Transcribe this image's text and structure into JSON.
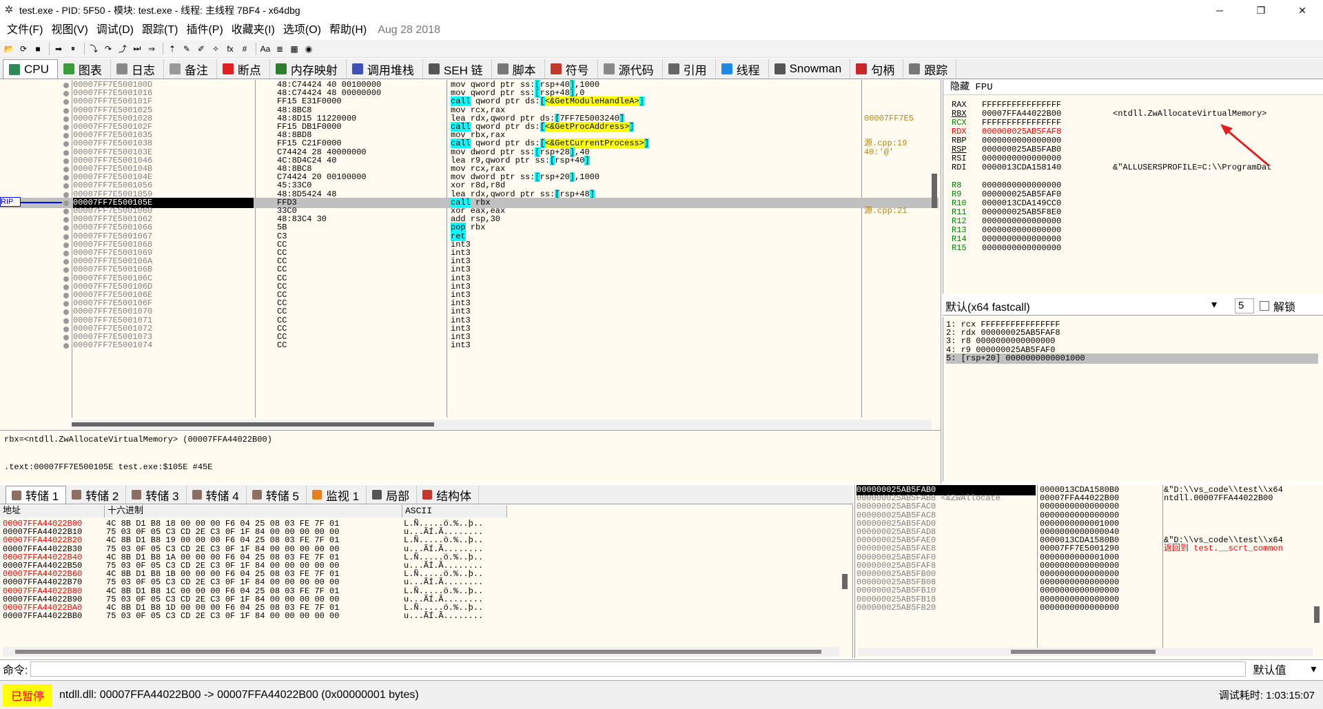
{
  "title": "test.exe - PID: 5F50 - 模块: test.exe - 线程: 主线程 7BF4 - x64dbg",
  "window_controls": {
    "minimize": "─",
    "maximize": "❐",
    "close": "✕"
  },
  "menu": [
    "文件(F)",
    "视图(V)",
    "调试(D)",
    "跟踪(T)",
    "插件(P)",
    "收藏夹(I)",
    "选项(O)",
    "帮助(H)"
  ],
  "menu_date": "Aug 28 2018",
  "toolbar_icons": [
    "open-icon",
    "restart-icon",
    "stop-icon",
    "run-icon",
    "pause-icon",
    "step-into-icon",
    "step-over-icon",
    "run-to-return-icon",
    "execute-till-user-icon",
    "animate-into-icon",
    "patch-icon",
    "comment-icon",
    "label-icon",
    "bookmark-icon",
    "function-icon",
    "hash-icon",
    "font-icon",
    "strings-icon",
    "calculator-icon",
    "globe-icon"
  ],
  "toolbar_glyphs": [
    "📂",
    "⟳",
    "■",
    "➡",
    "⏸",
    "⤵",
    "↷",
    "⤴",
    "⏭",
    "⇒",
    "⇡",
    "✎",
    "✐",
    "✧",
    "fx",
    "#",
    "Aa",
    "≣",
    "▦",
    "◉"
  ],
  "tabs": [
    {
      "label": "CPU",
      "color": "#2e8b57"
    },
    {
      "label": "图表",
      "color": "#3a9d3a"
    },
    {
      "label": "日志",
      "color": "#888888"
    },
    {
      "label": "备注",
      "color": "#999999"
    },
    {
      "label": "断点",
      "color": "#e02020"
    },
    {
      "label": "内存映射",
      "color": "#2e7d32"
    },
    {
      "label": "调用堆栈",
      "color": "#3f51b5"
    },
    {
      "label": "SEH 链",
      "color": "#555555"
    },
    {
      "label": "脚本",
      "color": "#777777"
    },
    {
      "label": "符号",
      "color": "#c0392b"
    },
    {
      "label": "源代码",
      "color": "#888888"
    },
    {
      "label": "引用",
      "color": "#666666"
    },
    {
      "label": "线程",
      "color": "#1e88e5"
    },
    {
      "label": "Snowman",
      "color": "#555555"
    },
    {
      "label": "句柄",
      "color": "#c62828"
    },
    {
      "label": "跟踪",
      "color": "#777777"
    }
  ],
  "disasm": [
    {
      "addr": "00007FF7E500100D",
      "bytes": "48:C74424 40 00100000",
      "dis": "mov qword ptr ss:[rsp+40],1000",
      "cmt": ""
    },
    {
      "addr": "00007FF7E5001016",
      "bytes": "48:C74424 48 00000000",
      "dis": "mov qword ptr ss:[rsp+48],0",
      "cmt": ""
    },
    {
      "addr": "00007FF7E500101F",
      "bytes": "FF15 E31F0000",
      "dis": "call qword ptr ds:[<&GetModuleHandleA>]",
      "cmt": ""
    },
    {
      "addr": "00007FF7E5001025",
      "bytes": "48:8BC8",
      "dis": "mov rcx,rax",
      "cmt": ""
    },
    {
      "addr": "00007FF7E5001028",
      "bytes": "48:8D15 11220000",
      "dis": "lea rdx,qword ptr ds:[7FF7E5003240]",
      "cmt": "00007FF7E5"
    },
    {
      "addr": "00007FF7E500102F",
      "bytes": "FF15 DB1F0000",
      "dis": "call qword ptr ds:[<&GetProcAddress>]",
      "cmt": ""
    },
    {
      "addr": "00007FF7E5001035",
      "bytes": "48:8BD8",
      "dis": "mov rbx,rax",
      "cmt": ""
    },
    {
      "addr": "00007FF7E5001038",
      "bytes": "FF15 C21F0000",
      "dis": "call qword ptr ds:[<&GetCurrentProcess>]",
      "cmt": "源.cpp:19"
    },
    {
      "addr": "00007FF7E500103E",
      "bytes": "C74424 28 40000000",
      "dis": "mov dword ptr ss:[rsp+28],40",
      "cmt": "40:'@'"
    },
    {
      "addr": "00007FF7E5001046",
      "bytes": "4C:8D4C24 40",
      "dis": "lea r9,qword ptr ss:[rsp+40]",
      "cmt": ""
    },
    {
      "addr": "00007FF7E500104B",
      "bytes": "48:8BC8",
      "dis": "mov rcx,rax",
      "cmt": ""
    },
    {
      "addr": "00007FF7E500104E",
      "bytes": "C74424 20 00100000",
      "dis": "mov dword ptr ss:[rsp+20],1000",
      "cmt": ""
    },
    {
      "addr": "00007FF7E5001056",
      "bytes": "45:33C0",
      "dis": "xor r8d,r8d",
      "cmt": ""
    },
    {
      "addr": "00007FF7E5001059",
      "bytes": "48:8D5424 48",
      "dis": "lea rdx,qword ptr ss:[rsp+48]",
      "cmt": ""
    },
    {
      "addr": "00007FF7E500105E",
      "bytes": "FFD3",
      "dis": "call rbx",
      "cmt": ""
    },
    {
      "addr": "00007FF7E5001060",
      "bytes": "33C0",
      "dis": "xor eax,eax",
      "cmt": "源.cpp:21"
    },
    {
      "addr": "00007FF7E5001062",
      "bytes": "48:83C4 30",
      "dis": "add rsp,30",
      "cmt": ""
    },
    {
      "addr": "00007FF7E5001066",
      "bytes": "5B",
      "dis": "pop rbx",
      "cmt": ""
    },
    {
      "addr": "00007FF7E5001067",
      "bytes": "C3",
      "dis": "ret",
      "cmt": ""
    },
    {
      "addr": "00007FF7E5001068",
      "bytes": "CC",
      "dis": "int3",
      "cmt": ""
    },
    {
      "addr": "00007FF7E5001069",
      "bytes": "CC",
      "dis": "int3",
      "cmt": ""
    },
    {
      "addr": "00007FF7E500106A",
      "bytes": "CC",
      "dis": "int3",
      "cmt": ""
    },
    {
      "addr": "00007FF7E500106B",
      "bytes": "CC",
      "dis": "int3",
      "cmt": ""
    },
    {
      "addr": "00007FF7E500106C",
      "bytes": "CC",
      "dis": "int3",
      "cmt": ""
    },
    {
      "addr": "00007FF7E500106D",
      "bytes": "CC",
      "dis": "int3",
      "cmt": ""
    },
    {
      "addr": "00007FF7E500106E",
      "bytes": "CC",
      "dis": "int3",
      "cmt": ""
    },
    {
      "addr": "00007FF7E500106F",
      "bytes": "CC",
      "dis": "int3",
      "cmt": ""
    },
    {
      "addr": "00007FF7E5001070",
      "bytes": "CC",
      "dis": "int3",
      "cmt": ""
    },
    {
      "addr": "00007FF7E5001071",
      "bytes": "CC",
      "dis": "int3",
      "cmt": ""
    },
    {
      "addr": "00007FF7E5001072",
      "bytes": "CC",
      "dis": "int3",
      "cmt": ""
    },
    {
      "addr": "00007FF7E5001073",
      "bytes": "CC",
      "dis": "int3",
      "cmt": ""
    },
    {
      "addr": "00007FF7E5001074",
      "bytes": "CC",
      "dis": "int3",
      "cmt": ""
    }
  ],
  "rip_label": "RIP",
  "rip_index": 14,
  "info": {
    "line1": "rbx=<ntdll.ZwAllocateVirtualMemory> (00007FFA44022B00)",
    "line2": ".text:00007FF7E500105E test.exe:$105E #45E"
  },
  "regs_header": "隐藏 FPU",
  "registers": [
    {
      "name": "RAX",
      "value": "FFFFFFFFFFFFFFFF",
      "note": "",
      "changed": false
    },
    {
      "name": "RBX",
      "value": "00007FFA44022B00",
      "note": "<ntdll.ZwAllocateVirtualMemory>",
      "changed": false
    },
    {
      "name": "RCX",
      "value": "FFFFFFFFFFFFFFFF",
      "note": "",
      "changed": false
    },
    {
      "name": "RDX",
      "value": "000000025AB5FAF8",
      "note": "",
      "changed": true
    },
    {
      "name": "RBP",
      "value": "0000000000000000",
      "note": "",
      "changed": false
    },
    {
      "name": "RSP",
      "value": "000000025AB5FAB0",
      "note": "",
      "changed": false
    },
    {
      "name": "RSI",
      "value": "0000000000000000",
      "note": "",
      "changed": false
    },
    {
      "name": "RDI",
      "value": "0000013CDA158140",
      "note": "&\"ALLUSERSPROFILE=C:\\\\ProgramDat",
      "changed": false
    },
    {
      "name": "",
      "value": "",
      "note": "",
      "changed": false
    },
    {
      "name": "R8",
      "value": "0000000000000000",
      "note": "",
      "changed": false
    },
    {
      "name": "R9",
      "value": "000000025AB5FAF0",
      "note": "",
      "changed": false
    },
    {
      "name": "R10",
      "value": "0000013CDA149CC0",
      "note": "",
      "changed": false
    },
    {
      "name": "R11",
      "value": "000000025AB5F8E0",
      "note": "",
      "changed": false
    },
    {
      "name": "R12",
      "value": "0000000000000000",
      "note": "",
      "changed": false
    },
    {
      "name": "R13",
      "value": "0000000000000000",
      "note": "",
      "changed": false
    },
    {
      "name": "R14",
      "value": "0000000000000000",
      "note": "",
      "changed": false
    },
    {
      "name": "R15",
      "value": "0000000000000000",
      "note": "",
      "changed": false
    }
  ],
  "callconv": {
    "label": "默认(x64 fastcall)",
    "count": "5",
    "unlock": "解锁"
  },
  "args": [
    "1: rcx FFFFFFFFFFFFFFFF",
    "2: rdx 000000025AB5FAF8",
    "3: r8 0000000000000000",
    "4: r9 000000025AB5FAF0",
    "5: [rsp+20] 0000000000001000"
  ],
  "bottom_tabs": [
    {
      "label": "转储 1",
      "color": "#8d6e63"
    },
    {
      "label": "转储 2",
      "color": "#8d6e63"
    },
    {
      "label": "转储 3",
      "color": "#8d6e63"
    },
    {
      "label": "转储 4",
      "color": "#8d6e63"
    },
    {
      "label": "转储 5",
      "color": "#8d6e63"
    },
    {
      "label": "监视 1",
      "color": "#e67e22"
    },
    {
      "label": "局部",
      "color": "#555555"
    },
    {
      "label": "结构体",
      "color": "#c0392b"
    }
  ],
  "dump_headers": {
    "addr": "地址",
    "hex": "十六进制",
    "ascii": "ASCII"
  },
  "dump": [
    {
      "a": "00007FFA44022B00",
      "h": "4C 8B D1 B8 18 00 00 00 F6 04 25 08 03 FE 7F 01",
      "c": "L.Ñ.....ö.%..þ.."
    },
    {
      "a": "00007FFA44022B10",
      "h": "75 03 0F 05 C3 CD 2E C3 0F 1F 84 00 00 00 00 00",
      "c": "u...ÃÍ.Ã........"
    },
    {
      "a": "00007FFA44022B20",
      "h": "4C 8B D1 B8 19 00 00 00 F6 04 25 08 03 FE 7F 01",
      "c": "L.Ñ.....ö.%..þ.."
    },
    {
      "a": "00007FFA44022B30",
      "h": "75 03 0F 05 C3 CD 2E C3 0F 1F 84 00 00 00 00 00",
      "c": "u...ÃÍ.Ã........"
    },
    {
      "a": "00007FFA44022B40",
      "h": "4C 8B D1 B8 1A 00 00 00 F6 04 25 08 03 FE 7F 01",
      "c": "L.Ñ.....ö.%..þ.."
    },
    {
      "a": "00007FFA44022B50",
      "h": "75 03 0F 05 C3 CD 2E C3 0F 1F 84 00 00 00 00 00",
      "c": "u...ÃÍ.Ã........"
    },
    {
      "a": "00007FFA44022B60",
      "h": "4C 8B D1 B8 1B 00 00 00 F6 04 25 08 03 FE 7F 01",
      "c": "L.Ñ.....ö.%..þ.."
    },
    {
      "a": "00007FFA44022B70",
      "h": "75 03 0F 05 C3 CD 2E C3 0F 1F 84 00 00 00 00 00",
      "c": "u...ÃÍ.Ã........"
    },
    {
      "a": "00007FFA44022B80",
      "h": "4C 8B D1 B8 1C 00 00 00 F6 04 25 08 03 FE 7F 01",
      "c": "L.Ñ.....ö.%..þ.."
    },
    {
      "a": "00007FFA44022B90",
      "h": "75 03 0F 05 C3 CD 2E C3 0F 1F 84 00 00 00 00 00",
      "c": "u...ÃÍ.Ã........"
    },
    {
      "a": "00007FFA44022BA0",
      "h": "4C 8B D1 B8 1D 00 00 00 F6 04 25 08 03 FE 7F 01",
      "c": "L.Ñ.....ö.%..þ.."
    },
    {
      "a": "00007FFA44022BB0",
      "h": "75 03 0F 05 C3 CD 2E C3 0F 1F 84 00 00 00 00 00",
      "c": "u...ÃÍ.Ã........"
    }
  ],
  "stack": [
    {
      "a": "000000025AB5FAB0",
      "v": "0000013CDA1580B0",
      "c": "&\"D:\\\\vs_code\\\\test\\\\x64"
    },
    {
      "a": "000000025AB5FAB8 <&ZwAllocate",
      "v": "00007FFA44022B00",
      "c": "ntdll.00007FFA44022B00"
    },
    {
      "a": "000000025AB5FAC0",
      "v": "0000000000000000",
      "c": ""
    },
    {
      "a": "000000025AB5FAC8",
      "v": "0000000000000000",
      "c": ""
    },
    {
      "a": "000000025AB5FAD0",
      "v": "0000000000001000",
      "c": ""
    },
    {
      "a": "000000025AB5FAD8",
      "v": "0000000000000040",
      "c": ""
    },
    {
      "a": "000000025AB5FAE0",
      "v": "0000013CDA1580B0",
      "c": "&\"D:\\\\vs_code\\\\test\\\\x64"
    },
    {
      "a": "000000025AB5FAE8",
      "v": "00007FF7E5001290",
      "c": "返回到 test.__scrt_common"
    },
    {
      "a": "000000025AB5FAF0",
      "v": "0000000000001000",
      "c": ""
    },
    {
      "a": "000000025AB5FAF8",
      "v": "0000000000000000",
      "c": ""
    },
    {
      "a": "000000025AB5FB00",
      "v": "0000000000000000",
      "c": ""
    },
    {
      "a": "000000025AB5FB08",
      "v": "0000000000000000",
      "c": ""
    },
    {
      "a": "000000025AB5FB10",
      "v": "0000000000000000",
      "c": ""
    },
    {
      "a": "000000025AB5FB18",
      "v": "0000000000000000",
      "c": ""
    },
    {
      "a": "000000025AB5FB20",
      "v": "0000000000000000",
      "c": ""
    }
  ],
  "command": {
    "label": "命令:",
    "default": "默认值"
  },
  "status": {
    "paused": "已暂停",
    "text": "ntdll.dll: 00007FFA44022B00 -> 00007FFA44022B00 (0x00000001 bytes)",
    "time": "调试耗时:   1:03:15:07"
  },
  "colors": {
    "accent_red": "#ff0000",
    "call_bg": "#00ffff",
    "label_bg": "#ffff00",
    "paused_bg": "#ffff00"
  }
}
